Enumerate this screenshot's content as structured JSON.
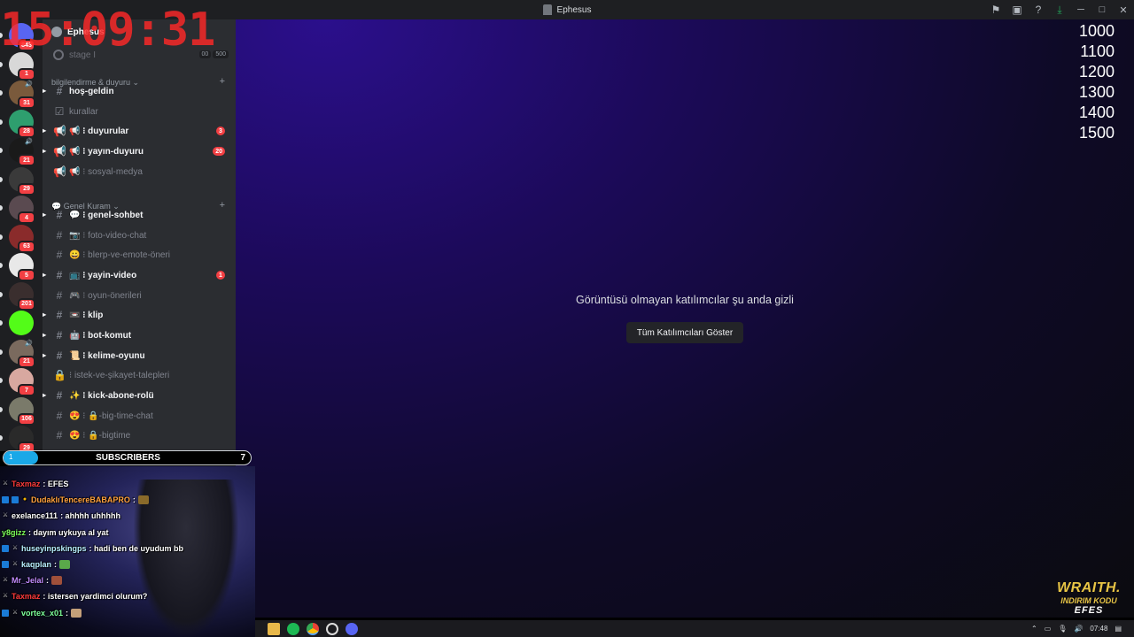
{
  "window": {
    "title": "Ephesus",
    "icons": [
      "flag-icon",
      "screen-icon",
      "help-icon",
      "download-icon"
    ],
    "controls": [
      "minimize",
      "maximize",
      "close"
    ]
  },
  "clock": "15:09:31",
  "servers": [
    {
      "badge": "843",
      "color": "#5865f2"
    },
    {
      "badge": "1",
      "color": "#d8d8d8"
    },
    {
      "badge": "31",
      "color": "#7a5a3c",
      "vol": "🔊"
    },
    {
      "badge": "28",
      "color": "#2e9e6e"
    },
    {
      "badge": "21",
      "color": "#1a1a1a",
      "vol": "🔊"
    },
    {
      "badge": "29",
      "color": "#3a3a3a"
    },
    {
      "badge": "4",
      "color": "#5a4a50"
    },
    {
      "badge": "63",
      "color": "#8a2b2b"
    },
    {
      "badge": "5",
      "color": "#e8e8e8"
    },
    {
      "badge": "201",
      "color": "#3a2e2e"
    },
    {
      "badge": "",
      "color": "#53fc18"
    },
    {
      "badge": "21",
      "color": "#7a6a5e",
      "vol": "🔊"
    },
    {
      "badge": "7",
      "color": "#d8a8a0"
    },
    {
      "badge": "106",
      "color": "#7a7a6a"
    },
    {
      "badge": "29",
      "color": "#2a2a2a"
    }
  ],
  "sidebar": {
    "server_name": "Ephesus",
    "stage": {
      "name": "stage I",
      "badges": [
        "00",
        "500"
      ]
    },
    "categories": [
      {
        "name": "bilgilendirme & duyuru",
        "icon": ""
      },
      {
        "name": "Genel Kuram",
        "icon": "💬"
      }
    ],
    "channels": [
      {
        "name": "hoş-geldin",
        "prefix": "",
        "icon": "#",
        "unread": true,
        "badge": ""
      },
      {
        "name": "kurallar",
        "prefix": "",
        "icon": "☑",
        "unread": false,
        "badge": ""
      },
      {
        "name": "duyurular",
        "prefix": "📢 ⁝ ",
        "icon": "📢",
        "unread": true,
        "badge": "3"
      },
      {
        "name": "yayın-duyuru",
        "prefix": "📢 ⁝ ",
        "icon": "📢",
        "unread": true,
        "badge": "20"
      },
      {
        "name": "sosyal-medya",
        "prefix": "📢 ⁝ ",
        "icon": "📢",
        "unread": false,
        "badge": ""
      },
      {
        "name": "genel-sohbet",
        "prefix": "💬 ⁝ ",
        "icon": "#",
        "unread": true,
        "badge": ""
      },
      {
        "name": "foto-video-chat",
        "prefix": "📷 ⁝ ",
        "icon": "#",
        "unread": false,
        "badge": ""
      },
      {
        "name": "blerp-ve-emote-öneri",
        "prefix": "😀 ⁝ ",
        "icon": "#",
        "unread": false,
        "badge": ""
      },
      {
        "name": "yayin-video",
        "prefix": "📺 ⁝ ",
        "icon": "#",
        "unread": true,
        "badge": "1"
      },
      {
        "name": "oyun-önerileri",
        "prefix": "🎮 ⁝ ",
        "icon": "#",
        "unread": false,
        "badge": ""
      },
      {
        "name": "klip",
        "prefix": "📼 ⁝ ",
        "icon": "#",
        "unread": true,
        "badge": ""
      },
      {
        "name": "bot-komut",
        "prefix": "🤖 ⁝ ",
        "icon": "#",
        "unread": true,
        "badge": ""
      },
      {
        "name": "kelime-oyunu",
        "prefix": "📜 ⁝ ",
        "icon": "#",
        "unread": true,
        "badge": ""
      },
      {
        "name": "istek-ve-şikayet-talepleri",
        "prefix": "⁝ ",
        "icon": "🔒",
        "unread": false,
        "badge": ""
      },
      {
        "name": "kick-abone-rolü",
        "prefix": "✨ ⁝ ",
        "icon": "#",
        "unread": true,
        "badge": ""
      },
      {
        "name": "-big-time-chat",
        "prefix": "😍 ⁝ 🔒",
        "icon": "#",
        "unread": false,
        "badge": ""
      },
      {
        "name": "-bigtime",
        "prefix": "😍 ⁝ 🔒",
        "icon": "#",
        "unread": false,
        "badge": ""
      }
    ]
  },
  "main": {
    "hidden_message": "Görüntüsü olmayan katılımcılar şu anda gizli",
    "show_button": "Tüm Katılımcıları Göster",
    "numbers": [
      "1000",
      "1100",
      "1200",
      "1300",
      "1400",
      "1500"
    ]
  },
  "subscribers": {
    "label": "SUBSCRIBERS",
    "current": "1",
    "goal": "7",
    "progress": 0.14
  },
  "chat": [
    {
      "user": "Taxmaz",
      "color": "#ff3b3b",
      "text": ": EFES",
      "badges": [
        "sword"
      ]
    },
    {
      "user": "DudaklıTencereBABAPRO",
      "color": "#ffa13d",
      "text": ": ",
      "badges": [
        "blue",
        "blue",
        "coin"
      ],
      "emote": "#8a6a2a"
    },
    {
      "user": "exelance111",
      "color": "#ffffff",
      "text": ": ahhhh uhhhhh",
      "badges": [
        "sword"
      ]
    },
    {
      "user": "y8gizz",
      "color": "#7dff5a",
      "text": ": dayım uykuya al yat",
      "badges": []
    },
    {
      "user": "huseyinpskingps",
      "color": "#b9f0ff",
      "text": ": hadi ben de uyudum bb",
      "badges": [
        "blue",
        "sword"
      ]
    },
    {
      "user": "kaqplan",
      "color": "#b9f0ff",
      "text": ": ",
      "badges": [
        "blue",
        "sword"
      ],
      "emote": "#5aa84a"
    },
    {
      "user": "Mr_Jelal",
      "color": "#c38cff",
      "text": ": ",
      "badges": [
        "sword"
      ],
      "emote": "#a0503a"
    },
    {
      "user": "Taxmaz",
      "color": "#ff3b3b",
      "text": ": istersen yardimci olurum?",
      "badges": [
        "sword"
      ]
    },
    {
      "user": "vortex_x01",
      "color": "#7dff9a",
      "text": ": ",
      "badges": [
        "blue",
        "sword"
      ],
      "emote": "#c4a07a"
    }
  ],
  "sponsor": {
    "brand": "WRAITH.",
    "code_label": "INDIRIM KODU",
    "code": "EFES"
  },
  "taskbar": {
    "apps": [
      "explorer",
      "spotify",
      "chrome",
      "obs",
      "discord"
    ],
    "time": "07:48"
  }
}
